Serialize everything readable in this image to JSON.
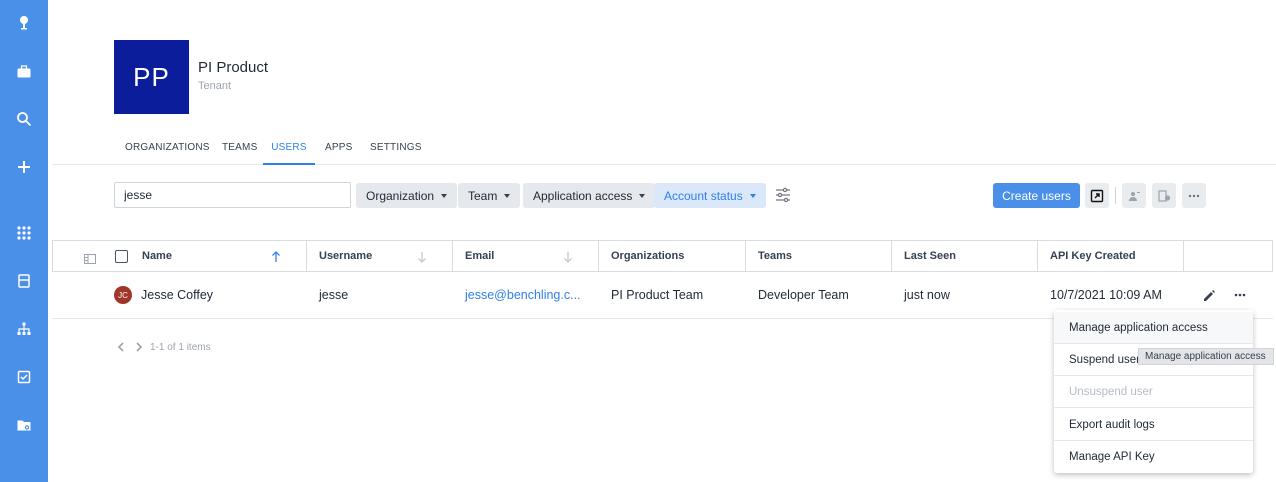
{
  "sidebar": {
    "icons": [
      "logo-icon",
      "briefcase-icon",
      "search-icon",
      "plus-icon",
      "apps-grid-icon",
      "inventory-icon",
      "hierarchy-icon",
      "tasks-icon",
      "folder-settings-icon"
    ]
  },
  "header": {
    "avatar_initials": "PP",
    "tenant_name": "PI Product",
    "tenant_type": "Tenant"
  },
  "tabs": [
    {
      "label": "ORGANIZATIONS",
      "active": false
    },
    {
      "label": "TEAMS",
      "active": false
    },
    {
      "label": "USERS",
      "active": true
    },
    {
      "label": "APPS",
      "active": false
    },
    {
      "label": "SETTINGS",
      "active": false
    }
  ],
  "toolbar": {
    "search_value": "jesse",
    "filters": {
      "organization": "Organization",
      "team": "Team",
      "application_access": "Application access",
      "account_status": "Account status"
    },
    "create_users_label": "Create users"
  },
  "table": {
    "columns": [
      "Name",
      "Username",
      "Email",
      "Organizations",
      "Teams",
      "Last Seen",
      "API Key Created"
    ],
    "rows": [
      {
        "initials": "JC",
        "name": "Jesse Coffey",
        "username": "jesse",
        "email": "jesse@benchling.c...",
        "organizations": "PI Product Team",
        "teams": "Developer Team",
        "last_seen": "just now",
        "api_key_created": "10/7/2021 10:09 AM"
      }
    ]
  },
  "pagination": {
    "summary": "1-1 of 1 items"
  },
  "row_menu": {
    "items": [
      {
        "label": "Manage application access",
        "disabled": false
      },
      {
        "label": "Suspend user",
        "disabled": false
      },
      {
        "label": "Unsuspend user",
        "disabled": true
      },
      {
        "label": "Export audit logs",
        "disabled": false
      },
      {
        "label": "Manage API Key",
        "disabled": false
      }
    ],
    "tooltip": "Manage application access"
  },
  "colors": {
    "sidebar": "#4a8fe8",
    "accent": "#2f80ed",
    "avatar_bg": "#0b1d9b",
    "user_avatar_bg": "#a0362a"
  }
}
